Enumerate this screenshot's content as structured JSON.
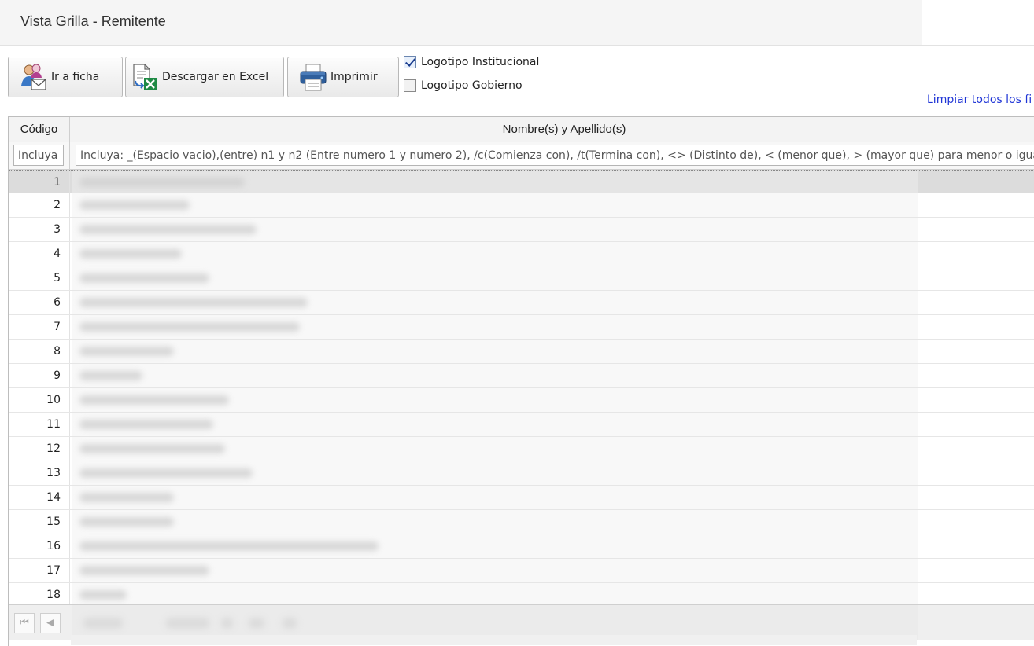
{
  "window": {
    "title": "Vista Grilla - Remitente"
  },
  "toolbar": {
    "goto_label": "Ir a ficha",
    "excel_label": "Descargar en Excel",
    "print_label": "Imprimir",
    "checkboxes": [
      {
        "label": "Logotipo Institucional",
        "checked": true
      },
      {
        "label": "Logotipo Gobierno",
        "checked": false
      }
    ],
    "clear_filters_label": "Limpiar todos los fi"
  },
  "grid": {
    "columns": [
      "Código",
      "Nombre(s) y Apellido(s)"
    ],
    "filters": {
      "code_value": "Incluya",
      "name_value": "Incluya: _(Espacio vacio),(entre) n1 y n2 (Entre numero 1 y numero 2), /c(Comienza con), /t(Termina con), <> (Distinto de), < (menor que), > (mayor que) para menor o igual"
    },
    "rows": [
      "1",
      "2",
      "3",
      "4",
      "5",
      "6",
      "7",
      "8",
      "9",
      "10",
      "11",
      "12",
      "13",
      "14",
      "15",
      "16",
      "17",
      "18"
    ]
  },
  "pager": {
    "first_icon": "first-page-icon",
    "prev_icon": "prev-page-icon"
  },
  "colors": {
    "link": "#1f35d6",
    "header_bg": "#f3f3f3",
    "selected_row": "#dcdcdc"
  }
}
